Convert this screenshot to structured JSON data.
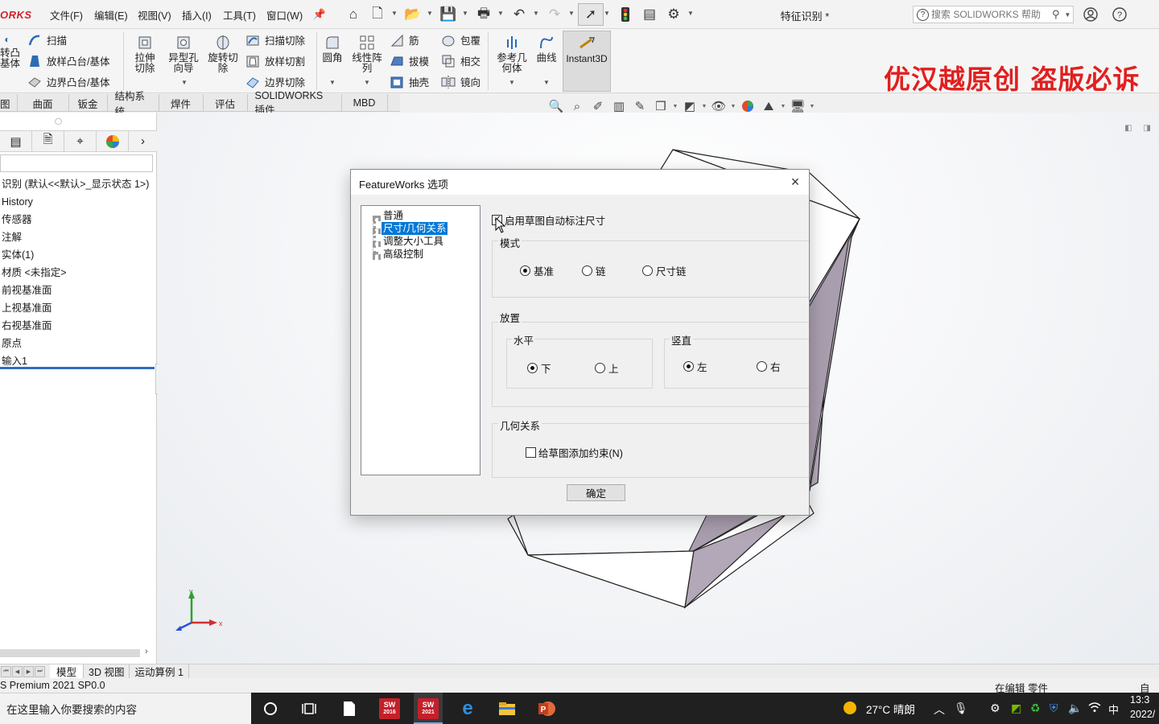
{
  "app": {
    "logo_text": "ORKS",
    "document_title": "特征识别 *",
    "menus": [
      "文件(F)",
      "编辑(E)",
      "视图(V)",
      "插入(I)",
      "工具(T)",
      "窗口(W)"
    ],
    "search_placeholder": "搜索 SOLIDWORKS 帮助"
  },
  "watermark": "优汉越原创 盗版必诉",
  "command_manager": {
    "left_cut_label_1": "转凸",
    "left_cut_label_2": "基体",
    "sweep": "扫描",
    "loft_boss": "放样凸台/基体",
    "boundary_boss": "边界凸台/基体",
    "extruded_cut": "拉伸切除",
    "hole_wizard": "异型孔向导",
    "revolved_cut": "旋转切除",
    "swept_cut": "扫描切除",
    "lofted_cut": "放样切割",
    "boundary_cut": "边界切除",
    "fillet": "圆角",
    "linear_pattern": "线性阵列",
    "rib": "筋",
    "draft": "拔模",
    "shell": "抽壳",
    "wrap": "包覆",
    "intersect": "相交",
    "mirror": "镜向",
    "ref_geometry": "参考几何体",
    "curves": "曲线",
    "instant3d": "Instant3D"
  },
  "tabs": [
    "图",
    "曲面",
    "钣金",
    "结构系统",
    "焊件",
    "评估",
    "SOLIDWORKS 插件",
    "MBD"
  ],
  "feature_tree": {
    "root": "识别 (默认<<默认>_显示状态 1>)",
    "items": [
      "History",
      "传感器",
      "注解",
      "实体(1)",
      "材质 <未指定>",
      "前视基准面",
      "上视基准面",
      "右视基准面",
      "原点",
      "输入1"
    ]
  },
  "dialog": {
    "title": "FeatureWorks 选项",
    "close_symbol": "×",
    "tree": [
      "普通",
      "尺寸/几何关系",
      "调整大小工具",
      "高级控制"
    ],
    "selected_index": 1,
    "auto_dim_label": "启用草图自动标注尺寸",
    "auto_dim_checked": true,
    "mode_group": "模式",
    "mode_options": [
      "基准",
      "链",
      "尺寸链"
    ],
    "mode_selected": "基准",
    "placement_group": "放置",
    "horizontal_group": "水平",
    "horizontal_options": [
      "下",
      "上"
    ],
    "horizontal_selected": "下",
    "vertical_group": "竖直",
    "vertical_options": [
      "左",
      "右"
    ],
    "vertical_selected": "左",
    "relations_group": "几何关系",
    "add_constraints_label": "给草图添加约束(N)",
    "add_constraints_checked": false,
    "ok_label": "确定"
  },
  "triad": {
    "x": "x",
    "y": "y"
  },
  "bottom_tabs": [
    "模型",
    "3D 视图",
    "运动算例 1"
  ],
  "status": {
    "left": "S Premium 2021 SP0.0",
    "editing": "在编辑 零件",
    "custom": "自定"
  },
  "taskbar": {
    "search_placeholder": "在这里输入你要搜索的内容",
    "sw2016": "2016",
    "sw2021": "2021",
    "sw_text": "SW",
    "weather": "27°C 晴朗",
    "ime": "中",
    "time": "13:3",
    "date": "2022/"
  }
}
